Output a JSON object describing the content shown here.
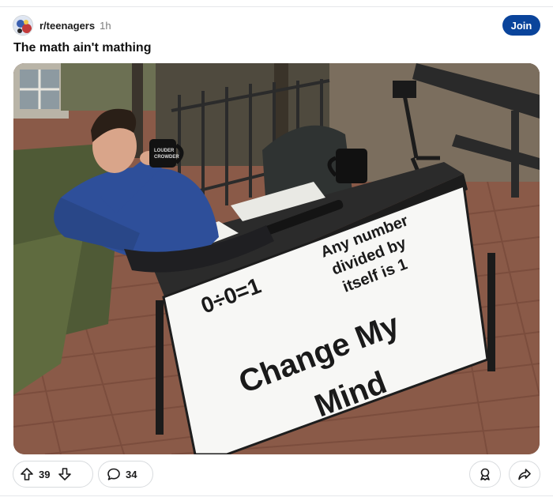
{
  "post": {
    "community": "r/teenagers",
    "time": "1h",
    "join_label": "Join",
    "title": "The math ain't mathing"
  },
  "meme": {
    "sign_top_left": "0÷0=1",
    "sign_top_right": [
      "Any number",
      "divided by",
      "itself is 1"
    ],
    "sign_bottom": [
      "Change My",
      "Mind"
    ],
    "mug_text": [
      "LOUDER",
      "CROWDER"
    ]
  },
  "actions": {
    "upvotes": "39",
    "comments": "34"
  },
  "icons": {
    "upvote": "arrow-up-icon",
    "downvote": "arrow-down-icon",
    "comment": "speech-bubble-icon",
    "award": "award-ribbon-icon",
    "share": "share-arrow-icon"
  }
}
